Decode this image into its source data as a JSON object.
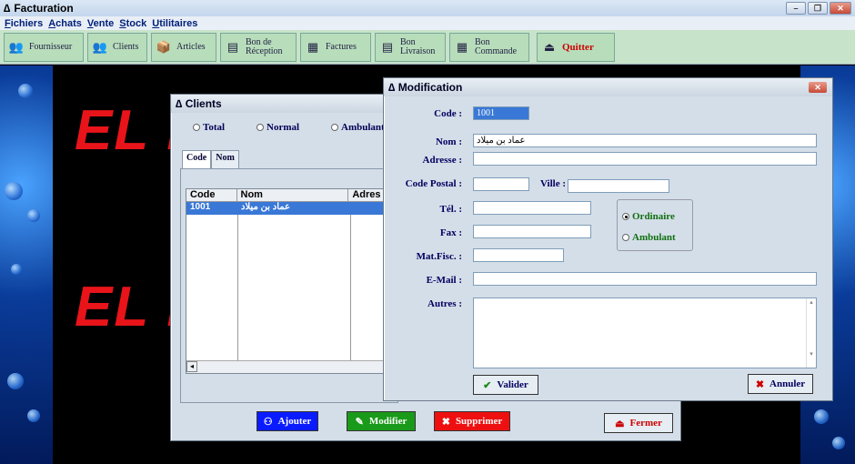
{
  "app": {
    "title": "Facturation"
  },
  "menu": [
    "Fichiers",
    "Achats",
    "Vente",
    "Stock",
    "Utilitaires"
  ],
  "toolbar": [
    {
      "label": "Fournisseur",
      "icon": "people-icon"
    },
    {
      "label": "Clients",
      "icon": "people-icon"
    },
    {
      "label": "Articles",
      "icon": "box-icon"
    },
    {
      "label1": "Bon de",
      "label2": "Réception",
      "icon": "document-icon"
    },
    {
      "label": "Factures",
      "icon": "grid-icon"
    },
    {
      "label1": "Bon",
      "label2": "Livraison",
      "icon": "document-icon"
    },
    {
      "label1": "Bon",
      "label2": "Commande",
      "icon": "grid-icon"
    },
    {
      "label": "Quitter",
      "icon": "exit-icon"
    }
  ],
  "background_text": "EL E",
  "clients": {
    "title": "Clients",
    "filters": [
      {
        "label": "Total"
      },
      {
        "label": "Normal"
      },
      {
        "label": "Ambulant"
      }
    ],
    "tabs": [
      "Code",
      "Nom"
    ],
    "columns": [
      "Code",
      "Nom",
      "Adres"
    ],
    "rows": [
      {
        "code": "1001",
        "nom": "عماد بن ميلاد"
      }
    ],
    "buttons": {
      "ajouter": "Ajouter",
      "modifier": "Modifier",
      "supprimer": "Supprimer",
      "fermer": "Fermer"
    }
  },
  "modification": {
    "title": "Modification",
    "labels": {
      "code": "Code :",
      "nom": "Nom :",
      "adresse": "Adresse :",
      "code_postal": "Code Postal :",
      "ville": "Ville :",
      "tel": "Tél. :",
      "fax": "Fax :",
      "mat_fisc": "Mat.Fisc. :",
      "email": "E-Mail :",
      "autres": "Autres :"
    },
    "values": {
      "code": "1001",
      "nom": "عماد بن ميلاد",
      "adresse": "",
      "code_postal": "",
      "ville": "",
      "tel": "",
      "fax": "",
      "mat_fisc": "",
      "email": "",
      "autres": ""
    },
    "type_options": [
      {
        "label": "Ordinaire",
        "selected": true
      },
      {
        "label": "Ambulant",
        "selected": false
      }
    ],
    "buttons": {
      "valider": "Valider",
      "annuler": "Annuler"
    }
  },
  "colors": {
    "ajouter": "#0a1cff",
    "modifier": "#1a9a1a",
    "supprimer": "#ee1010",
    "accent_red": "#e8141a"
  }
}
